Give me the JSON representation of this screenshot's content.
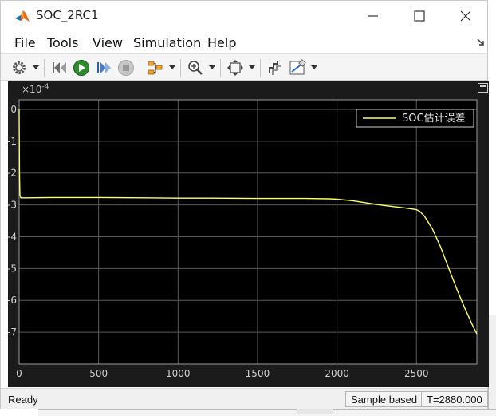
{
  "window": {
    "title": "SOC_2RC1"
  },
  "menu": {
    "items": [
      "File",
      "Tools",
      "View",
      "Simulation",
      "Help"
    ]
  },
  "toolbar": {
    "icons": [
      "gear-icon",
      "step-back-icon",
      "run-icon",
      "step-forward-icon",
      "stop-icon",
      "highlight-icon",
      "zoom-in-icon",
      "fit-to-view-icon",
      "cursor-measure-icon",
      "style-icon"
    ]
  },
  "scope": {
    "exponent_label": "×10",
    "exponent_power": "-4",
    "legend_label": "SOC估计误差",
    "background_color": "#000000",
    "line_color": "#ffff66",
    "grid_color": "#5a5a5a"
  },
  "chart_data": {
    "type": "line",
    "title": "",
    "xlabel": "",
    "ylabel": "",
    "xlim": [
      0,
      2880
    ],
    "ylim": [
      -8,
      0.3
    ],
    "x_ticks": [
      0,
      500,
      1000,
      1500,
      2000,
      2500
    ],
    "y_ticks": [
      0,
      -1,
      -2,
      -3,
      -4,
      -5,
      -6,
      -7
    ],
    "y_tick_labels": [
      "0",
      "-1",
      "-2",
      "-3",
      "-4",
      "-5",
      "-6",
      "-7"
    ],
    "x_tick_labels": [
      "0",
      "500",
      "1000",
      "1500",
      "2000",
      "2500"
    ],
    "grid": true,
    "legend": "top-right",
    "series": [
      {
        "name": "SOC估计误差",
        "x": [
          0,
          2,
          5,
          10,
          50,
          200,
          500,
          800,
          1000,
          1200,
          1500,
          1800,
          1950,
          2000,
          2100,
          2200,
          2300,
          2400,
          2450,
          2500,
          2520,
          2550,
          2600,
          2650,
          2700,
          2750,
          2800,
          2850,
          2880
        ],
        "y": [
          0,
          -2.0,
          -2.7,
          -2.78,
          -2.78,
          -2.77,
          -2.77,
          -2.78,
          -2.79,
          -2.79,
          -2.8,
          -2.8,
          -2.81,
          -2.82,
          -2.87,
          -2.95,
          -3.02,
          -3.08,
          -3.11,
          -3.15,
          -3.2,
          -3.35,
          -3.75,
          -4.3,
          -4.95,
          -5.6,
          -6.2,
          -6.75,
          -7.05
        ]
      }
    ]
  },
  "status": {
    "ready": "Ready",
    "mode": "Sample based",
    "time": "T=2880.000"
  }
}
